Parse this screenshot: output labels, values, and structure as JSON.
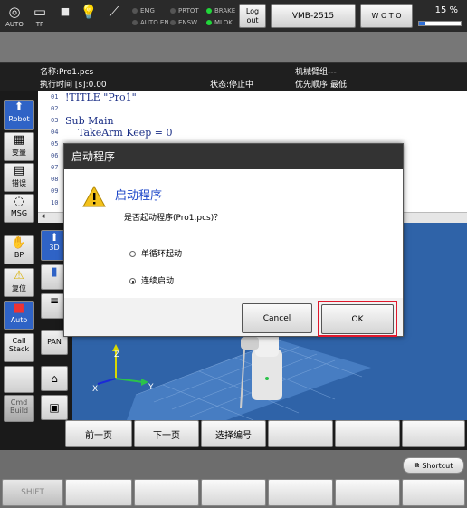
{
  "status": {
    "auto_label": "AUTO",
    "tp_label": "TP",
    "lamps": [
      {
        "label": "EMG",
        "on": false
      },
      {
        "label": "AUTO EN",
        "on": false
      },
      {
        "label": "PRTOT",
        "on": false
      },
      {
        "label": "ENSW",
        "on": false
      },
      {
        "label": "BRAKE",
        "on": true
      },
      {
        "label": "MLOK",
        "on": true
      }
    ],
    "logout_label": "Log out",
    "robot_model": "VMB-2515",
    "woto_label": "W O T O",
    "speed": "15 %",
    "speed_fraction": 0.15
  },
  "info": {
    "name": "名称:Pro1.pcs",
    "exec_time": "执行时间 [s]:0.00",
    "state": "状态:停止中",
    "arm_group": "机械臂组---",
    "priority": "优先顺序:最低"
  },
  "sidebar": {
    "robot": "Robot",
    "variables": "变量",
    "errors": "错误",
    "msg": "MSG",
    "bp": "BP",
    "reset": "复位",
    "auto": "Auto",
    "call_stack": "Call Stack",
    "cmd_build": "Cmd Build"
  },
  "col2": {
    "view3d": "3D",
    "pan": "PAN"
  },
  "editor": {
    "line_numbers": [
      "01",
      "02",
      "03",
      "04",
      "05",
      "06",
      "07",
      "08",
      "09",
      "10"
    ],
    "lines": [
      "!TITLE \"Pro1\"",
      "",
      "Sub Main",
      "    TakeArm Keep = 0"
    ]
  },
  "view": {
    "axis_x": "X",
    "axis_y": "Y",
    "axis_z": "Z"
  },
  "function_keys": [
    "前一页",
    "下一页",
    "选择编号",
    "",
    "",
    "",
    ""
  ],
  "bottom": {
    "shortcut": "Shortcut",
    "shift": "SHIFT"
  },
  "dialog": {
    "title": "启动程序",
    "heading": "启动程序",
    "question": "是否起动程序(Pro1.pcs)？",
    "options": [
      {
        "label": "单循环起动",
        "selected": false
      },
      {
        "label": "连续启动",
        "selected": true
      }
    ],
    "cancel": "Cancel",
    "ok": "OK"
  }
}
